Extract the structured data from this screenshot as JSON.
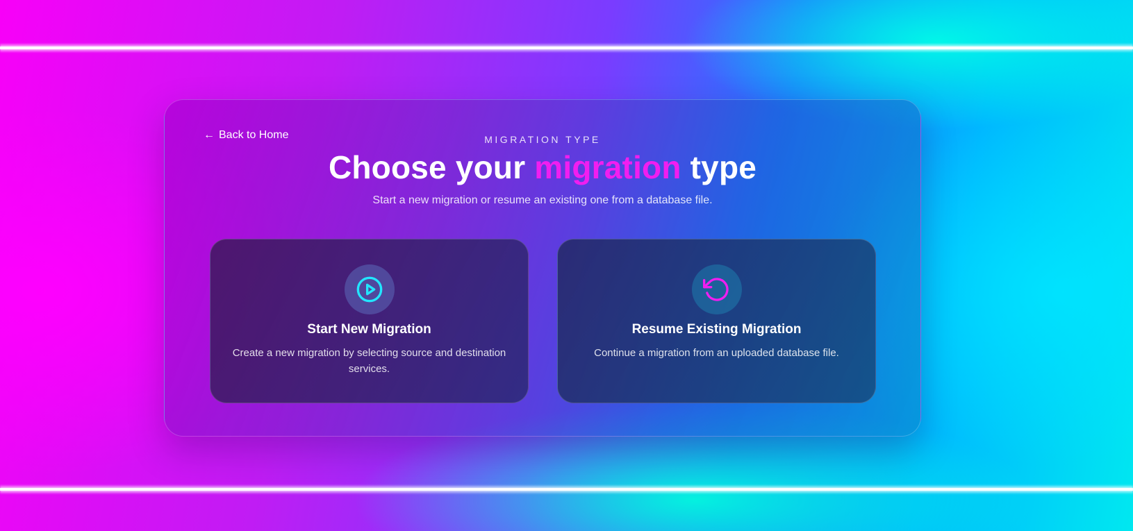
{
  "back_link": {
    "label": "Back to Home",
    "icon": "arrow-left-icon"
  },
  "header": {
    "eyebrow": "MIGRATION TYPE",
    "title_prefix": "Choose your ",
    "title_accent": "migration",
    "title_suffix": " type",
    "subtitle": "Start a new migration or resume an existing one from a database file."
  },
  "cards": [
    {
      "title": "Start New Migration",
      "description": "Create a new migration by selecting source and destination services.",
      "icon": "play-circle-icon",
      "icon_color": "#22e6ff"
    },
    {
      "title": "Resume Existing Migration",
      "description": "Continue a migration from an uploaded database file.",
      "icon": "rotate-ccw-icon",
      "icon_color": "#f01ef0"
    }
  ],
  "colors": {
    "accent_magenta": "#f01ef0",
    "accent_cyan": "#22e6ff",
    "text": "#ffffff"
  }
}
